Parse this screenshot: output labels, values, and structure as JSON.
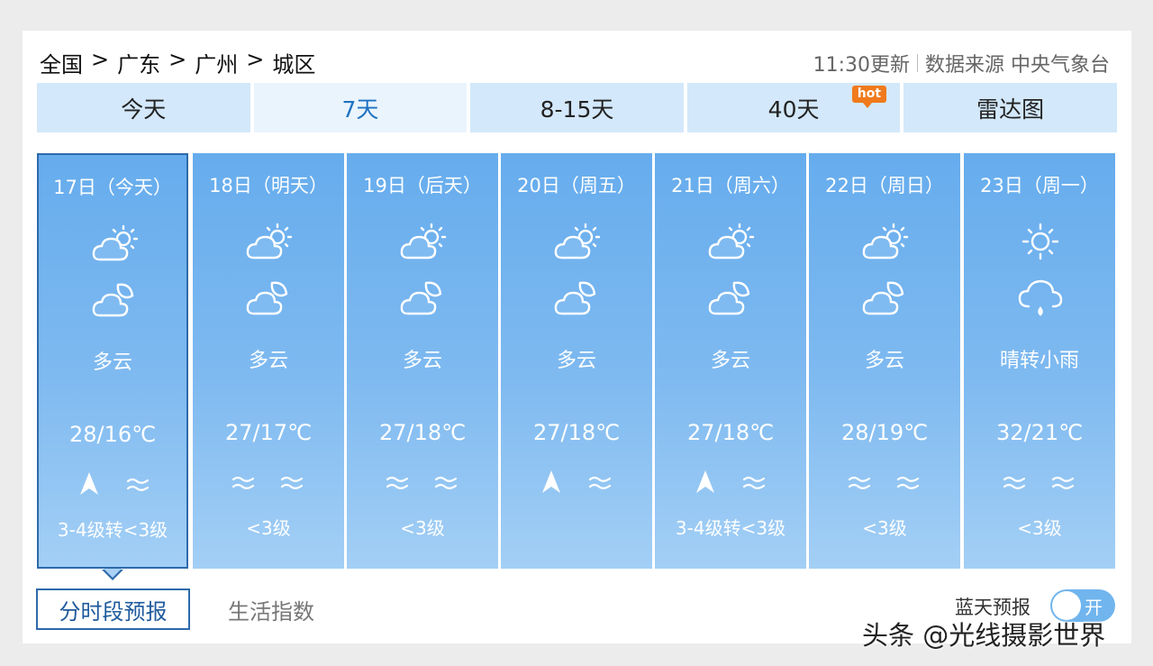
{
  "breadcrumb": {
    "country": "全国",
    "province": "广东",
    "city": "广州",
    "district": "城区",
    "separator": ">"
  },
  "update": {
    "time": "11:30更新",
    "source": "数据来源 中央气象台"
  },
  "tabs": [
    {
      "label": "今天"
    },
    {
      "label": "7天",
      "active": true
    },
    {
      "label": "8-15天"
    },
    {
      "label": "40天",
      "badge": "hot"
    },
    {
      "label": "雷达图"
    }
  ],
  "days": [
    {
      "date": "17日（今天）",
      "icon_day": "partly-cloudy-day-icon",
      "icon_night": "partly-cloudy-night-icon",
      "desc": "多云",
      "temp": "28/16℃",
      "wind_dir": "north-arrow-icon",
      "wind_level": "3-4级转<3级",
      "selected": true
    },
    {
      "date": "18日（明天）",
      "icon_day": "partly-cloudy-day-icon",
      "icon_night": "partly-cloudy-night-icon",
      "desc": "多云",
      "temp": "27/17℃",
      "wind_dir": "breeze-icon",
      "wind_level": "<3级"
    },
    {
      "date": "19日（后天）",
      "icon_day": "partly-cloudy-day-icon",
      "icon_night": "partly-cloudy-night-icon",
      "desc": "多云",
      "temp": "27/18℃",
      "wind_dir": "breeze-icon",
      "wind_level": "<3级"
    },
    {
      "date": "20日（周五）",
      "icon_day": "partly-cloudy-day-icon",
      "icon_night": "partly-cloudy-night-icon",
      "desc": "多云",
      "temp": "27/18℃",
      "wind_dir": "north-arrow-icon",
      "wind_level": "",
      "blurred": true
    },
    {
      "date": "21日（周六）",
      "icon_day": "partly-cloudy-day-icon",
      "icon_night": "partly-cloudy-night-icon",
      "desc": "多云",
      "temp": "27/18℃",
      "wind_dir": "north-arrow-icon",
      "wind_level": "3-4级转<3级"
    },
    {
      "date": "22日（周日）",
      "icon_day": "partly-cloudy-day-icon",
      "icon_night": "partly-cloudy-night-icon",
      "desc": "多云",
      "temp": "28/19℃",
      "wind_dir": "breeze-icon",
      "wind_level": "<3级"
    },
    {
      "date": "23日（周一）",
      "icon_day": "sunny-icon",
      "icon_night": "light-rain-icon",
      "desc": "晴转小雨",
      "temp": "32/21℃",
      "wind_dir": "breeze-icon",
      "wind_level": "<3级"
    }
  ],
  "bottom_tabs": {
    "hourly": "分时段预报",
    "life_index": "生活指数"
  },
  "blue_sky": {
    "label": "蓝天预报",
    "toggle_label": "开",
    "enabled": true
  },
  "watermark": "头条 @光线摄影世界",
  "colors": {
    "tab_bg": "#d3e8fa",
    "active_tab_text": "#1e73c2",
    "day_card": "#66aced",
    "hot_badge": "#f07a1c",
    "selected_border": "#2d6aaa"
  }
}
